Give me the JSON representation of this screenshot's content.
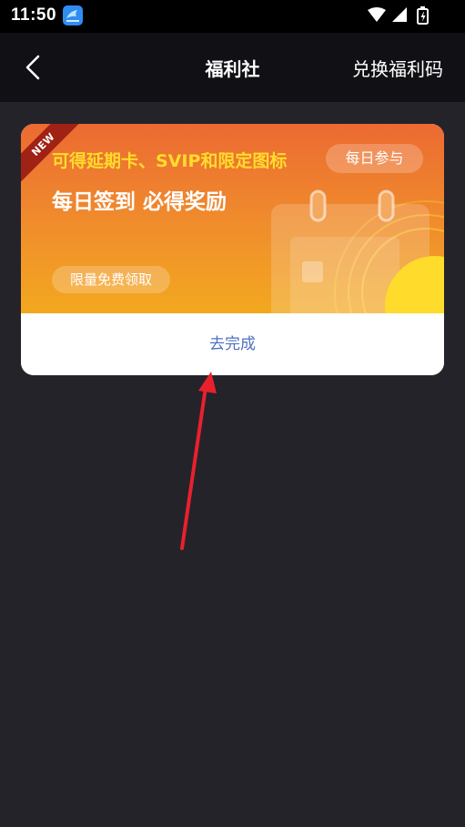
{
  "status_bar": {
    "time": "11:50",
    "app_icon": "app-notification-icon",
    "icons": [
      "wifi-icon",
      "cellular-signal-icon",
      "battery-charging-icon"
    ]
  },
  "header": {
    "back_icon": "back-arrow-icon",
    "title": "福利社",
    "redeem_label": "兑换福利码"
  },
  "card": {
    "ribbon": "NEW",
    "subtitle": "可得延期卡、SVIP和限定图标",
    "title": "每日签到 必得奖励",
    "daily_badge": "每日参与",
    "limited_badge": "限量免费领取",
    "illustration_icon": "calendar-sun-illustration",
    "action_label": "去完成"
  },
  "annotation": {
    "icon": "red-pointer-arrow"
  },
  "colors": {
    "background": "#24232a",
    "header": "#111014",
    "banner_top": "#ec6a32",
    "banner_bottom": "#f3a81f",
    "subtitle": "#ffdc2c",
    "ribbon": "#9f2214",
    "action_text": "#4e71c2",
    "arrow": "#e8212c"
  }
}
